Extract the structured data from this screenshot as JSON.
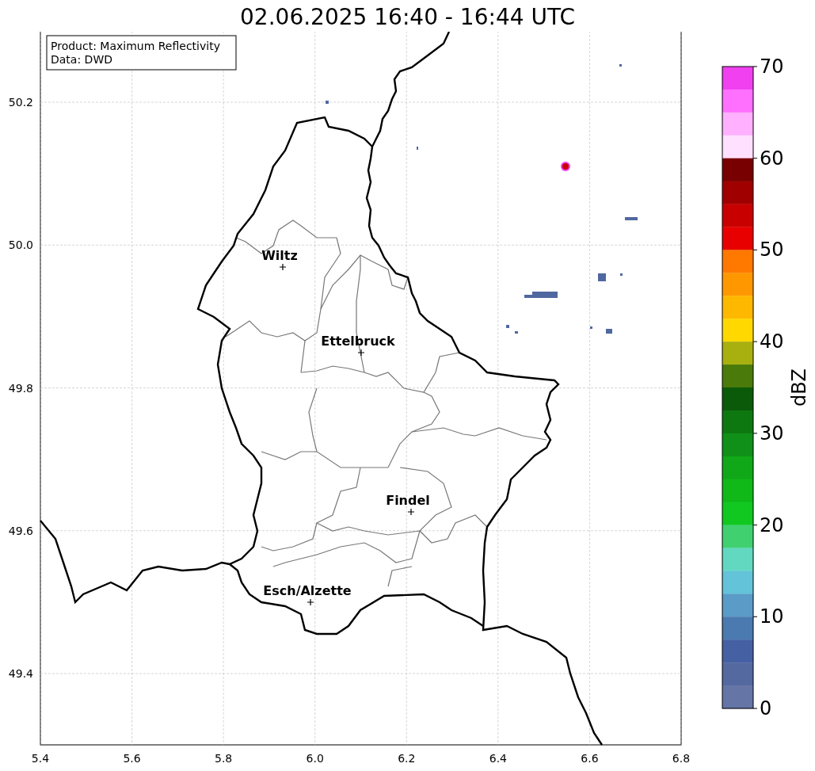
{
  "title": "02.06.2025 16:40 - 16:44 UTC",
  "info_box": [
    "Product: Maximum Reflectivity",
    "Data: DWD"
  ],
  "cities": [
    {
      "name": "Wiltz"
    },
    {
      "name": "Ettelbruck"
    },
    {
      "name": "Findel"
    },
    {
      "name": "Esch/Alzette"
    }
  ],
  "x_ticks": [
    "5.4",
    "5.6",
    "5.8",
    "6.0",
    "6.2",
    "6.4",
    "6.6",
    "6.8"
  ],
  "y_ticks": [
    "50.2",
    "50.0",
    "49.8",
    "49.6",
    "49.4"
  ],
  "colorbar": {
    "label": "dBZ",
    "ticks": [
      "70",
      "60",
      "50",
      "40",
      "30",
      "20",
      "10",
      "0"
    ],
    "bins": [
      {
        "color": "#f040f0"
      },
      {
        "color": "#ff70ff"
      },
      {
        "color": "#ffb0ff"
      },
      {
        "color": "#ffe0ff"
      },
      {
        "color": "#780000"
      },
      {
        "color": "#a00000"
      },
      {
        "color": "#c80000"
      },
      {
        "color": "#e80000"
      },
      {
        "color": "#ff7800"
      },
      {
        "color": "#ff9800"
      },
      {
        "color": "#ffb800"
      },
      {
        "color": "#ffd800"
      },
      {
        "color": "#a8b010"
      },
      {
        "color": "#4a7a0a"
      },
      {
        "color": "#0a5a0a"
      },
      {
        "color": "#0e7810"
      },
      {
        "color": "#109018"
      },
      {
        "color": "#10a818"
      },
      {
        "color": "#10b818"
      },
      {
        "color": "#10c820"
      },
      {
        "color": "#40d070"
      },
      {
        "color": "#62d8c0"
      },
      {
        "color": "#63c3d8"
      },
      {
        "color": "#5a9bc8"
      },
      {
        "color": "#4a7ab0"
      },
      {
        "color": "#4660a4"
      },
      {
        "color": "#5369a0"
      },
      {
        "color": "#6475a6"
      }
    ]
  }
}
